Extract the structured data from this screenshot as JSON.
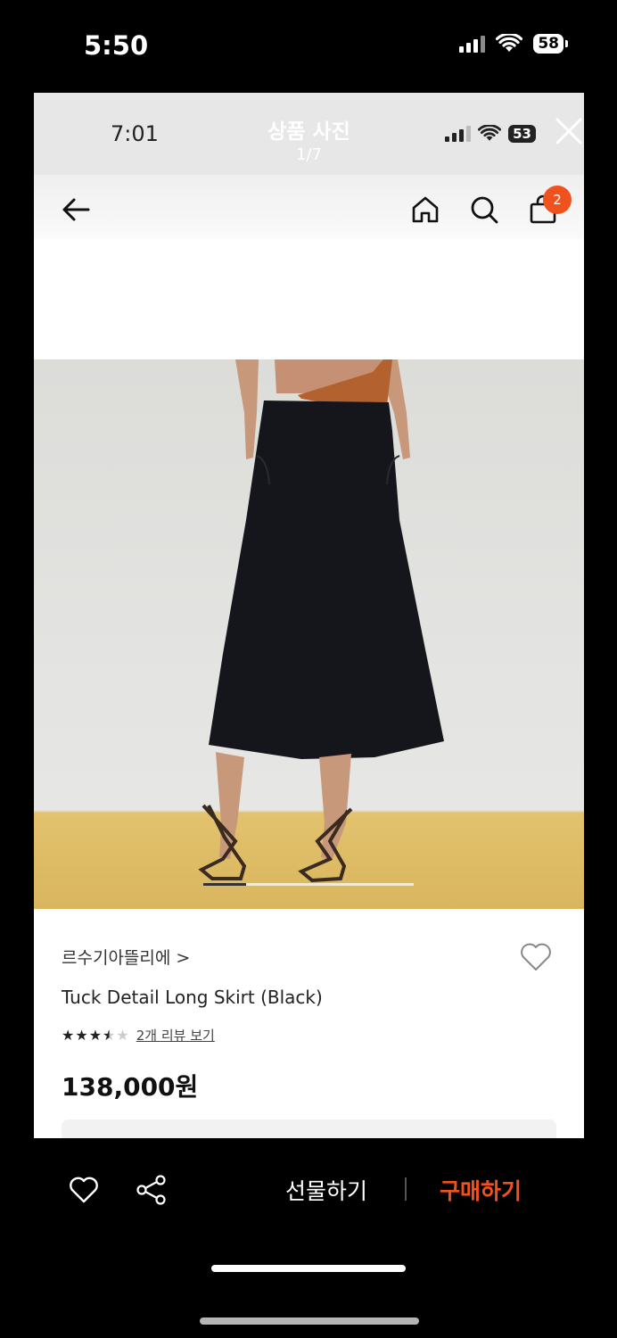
{
  "outer_status": {
    "time": "5:50",
    "battery": "58"
  },
  "viewer": {
    "title": "상품 사진",
    "counter": "1/7"
  },
  "inner_status": {
    "time": "7:01",
    "battery": "53"
  },
  "cart_badge": "2",
  "product": {
    "brand": "르수기아뜰리에 >",
    "name": "Tuck Detail Long Skirt (Black)",
    "rating_stars": 3.5,
    "stars_on": "★★★",
    "star_half": "★",
    "stars_off": "★",
    "review_link": "2개 리뷰 보기",
    "price": "138,000원",
    "image_index": 1,
    "image_total": 7
  },
  "bottom_bar": {
    "gift_label": "선물하기",
    "buy_label": "구매하기"
  },
  "colors": {
    "accent": "#f0521e",
    "screen_bg": "#ffffff",
    "frame_bg": "#000000"
  },
  "icons": [
    "signal-icon",
    "wifi-icon",
    "close-icon",
    "back-arrow-icon",
    "home-icon",
    "search-icon",
    "shopping-bag-icon",
    "heart-icon",
    "share-icon"
  ]
}
